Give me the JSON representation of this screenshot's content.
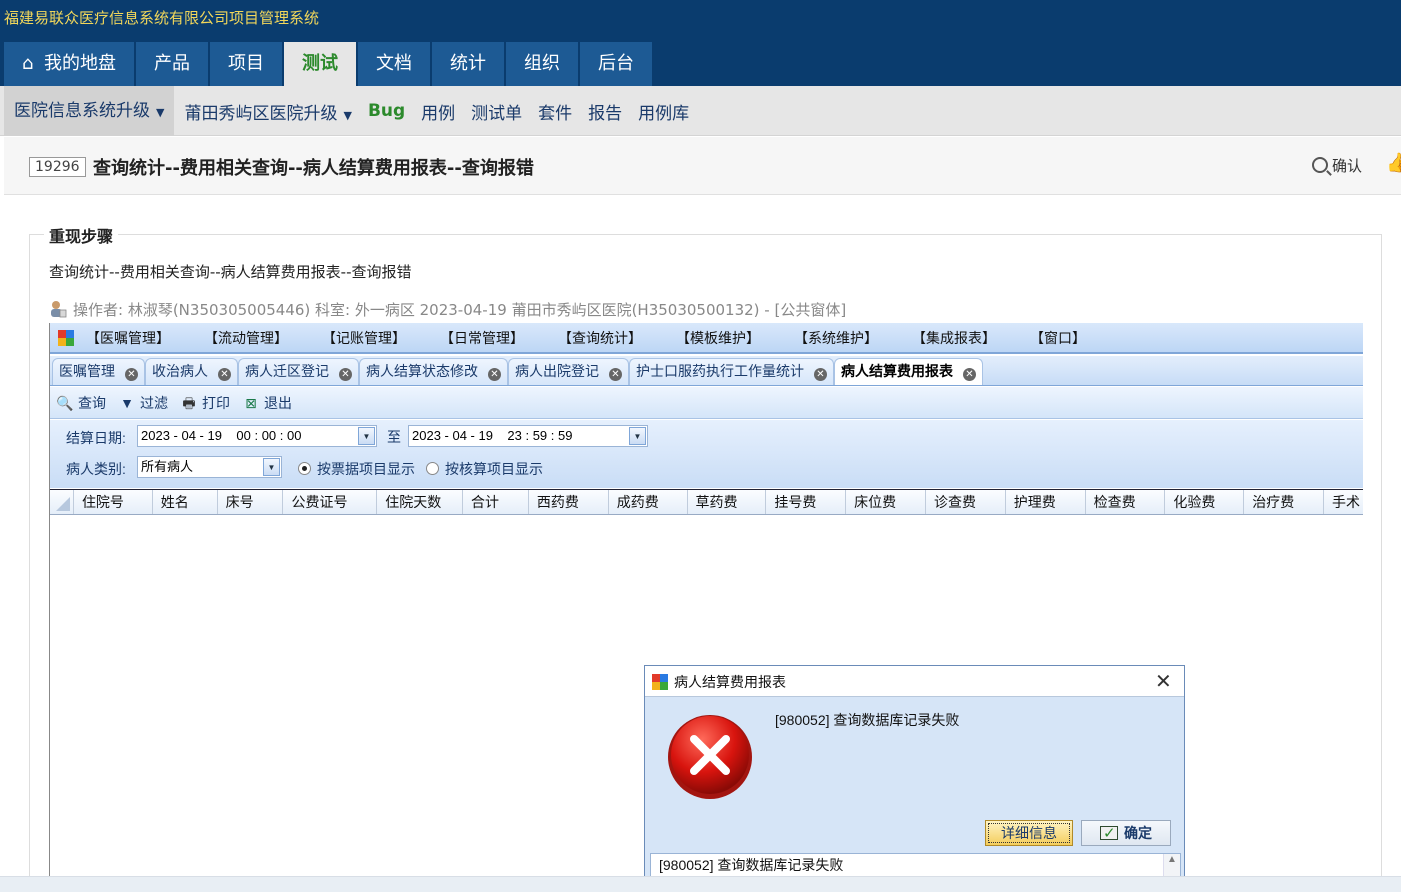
{
  "app": {
    "title": "福建易联众医疗信息系统有限公司项目管理系统"
  },
  "main_nav": [
    {
      "label": "我的地盘",
      "icon": "home-icon",
      "active": false
    },
    {
      "label": "产品",
      "active": false
    },
    {
      "label": "项目",
      "active": false
    },
    {
      "label": "测试",
      "active": true
    },
    {
      "label": "文档",
      "active": false
    },
    {
      "label": "统计",
      "active": false
    },
    {
      "label": "组织",
      "active": false
    },
    {
      "label": "后台",
      "active": false
    }
  ],
  "sub_nav": {
    "product": "医院信息系统升级",
    "project": "莆田秀屿区医院升级",
    "items": [
      "Bug",
      "用例",
      "测试单",
      "套件",
      "报告",
      "用例库"
    ]
  },
  "bug": {
    "id": "19296",
    "title": "查询统计--费用相关查询--病人结算费用报表--查询报错",
    "confirm_label": "确认"
  },
  "steps": {
    "label": "重现步骤",
    "text": "查询统计--费用相关查询--病人结算费用报表--查询报错",
    "operator_line": "操作者: 林淑琴(N350305005446) 科室: 外一病区 2023-04-19 莆田市秀屿区医院(H35030500132) - [公共窗体]"
  },
  "embedded_app": {
    "menu": [
      "【医嘱管理】",
      "【流动管理】",
      "【记账管理】",
      "【日常管理】",
      "【查询统计】",
      "【模板维护】",
      "【系统维护】",
      "【集成报表】",
      "【窗口】"
    ],
    "tabs": [
      {
        "label": "医嘱管理",
        "active": false
      },
      {
        "label": "收治病人",
        "active": false
      },
      {
        "label": "病人迁区登记",
        "active": false
      },
      {
        "label": "病人结算状态修改",
        "active": false
      },
      {
        "label": "病人出院登记",
        "active": false
      },
      {
        "label": "护士口服药执行工作量统计",
        "active": false
      },
      {
        "label": "病人结算费用报表",
        "active": true
      }
    ],
    "toolbar": [
      {
        "label": "查询",
        "icon": "search-icon"
      },
      {
        "label": "过滤",
        "icon": "filter-icon"
      },
      {
        "label": "打印",
        "icon": "printer-icon"
      },
      {
        "label": "退出",
        "icon": "exit-icon"
      }
    ],
    "filter": {
      "date_label": "结算日期:",
      "date_from": "2023 - 04 - 19    00 : 00 : 00",
      "to_label": "至",
      "date_to": "2023 - 04 - 19    23 : 59 : 59",
      "patient_type_label": "病人类别:",
      "patient_type_value": "所有病人",
      "radio_1": "按票据项目显示",
      "radio_2": "按核算项目显示",
      "radio_selected": 1
    },
    "grid_columns": [
      "住院号",
      "姓名",
      "床号",
      "公费证号",
      "住院天数",
      "合计",
      "西药费",
      "成药费",
      "草药费",
      "挂号费",
      "床位费",
      "诊查费",
      "护理费",
      "检查费",
      "化验费",
      "治疗费",
      "手术"
    ]
  },
  "dialog": {
    "title": "病人结算费用报表",
    "message": "[980052] 查询数据库记录失败",
    "detail_button": "详细信息",
    "ok_button": "确定",
    "detail_text": "[980052] 查询数据库记录失败"
  }
}
